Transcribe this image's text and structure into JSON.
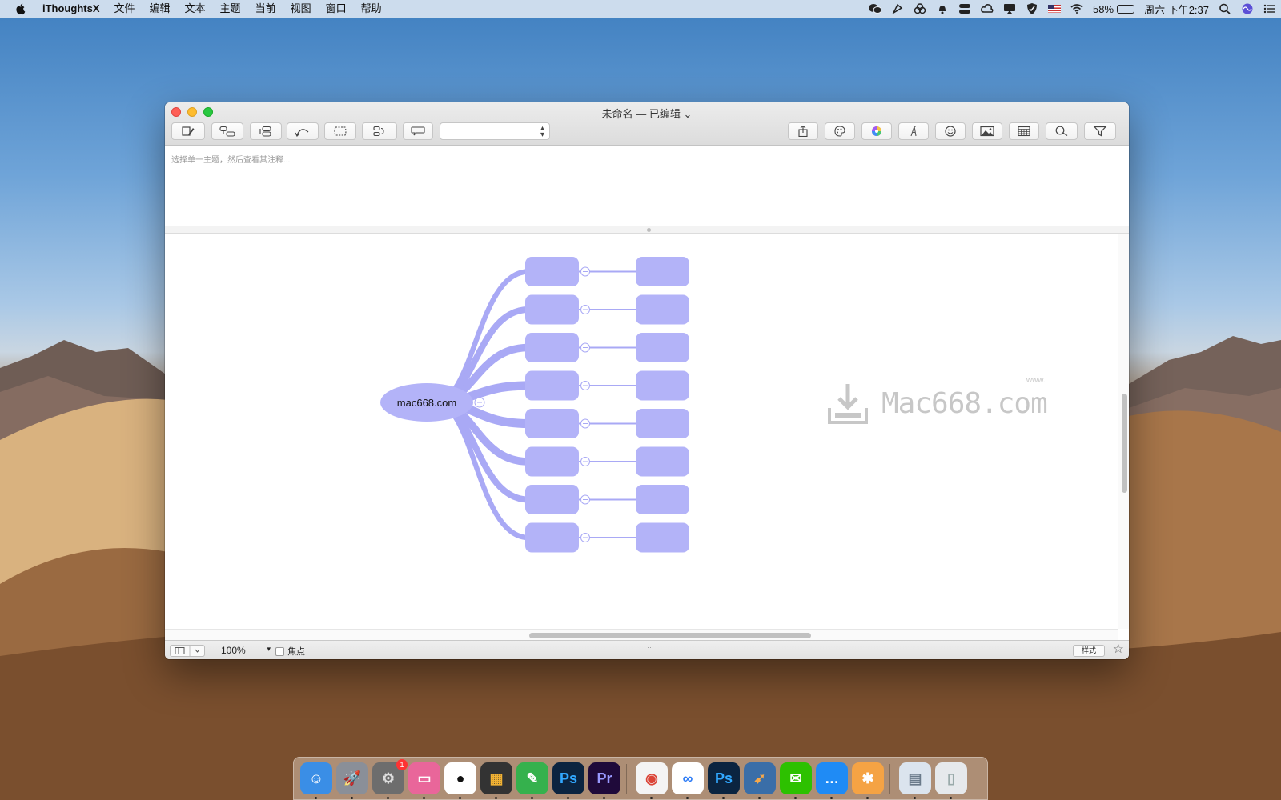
{
  "menubar": {
    "app_name": "iThoughtsX",
    "menus": [
      "文件",
      "编辑",
      "文本",
      "主题",
      "当前",
      "视图",
      "窗口",
      "帮助"
    ],
    "battery_percent": "58%",
    "battery_level": 0.58,
    "clock": "周六 下午2:37"
  },
  "window": {
    "title": "未命名 — 已编辑 ⌄",
    "notes_placeholder": "选择单一主题，然后查看其注释..."
  },
  "mindmap": {
    "root_label": "mac668.com",
    "node_color": "#b3b3f8",
    "branch_color": "#a9a9f5",
    "rows": 8
  },
  "watermark": {
    "text": "Mac668.com",
    "www": "www."
  },
  "statusbar": {
    "zoom": "100%",
    "focus_label": "焦点",
    "style_label": "样式"
  },
  "dock": {
    "apps": [
      {
        "name": "finder",
        "glyph": "☺",
        "bg": "#3a8ee6",
        "fg": "#fff"
      },
      {
        "name": "launchpad",
        "glyph": "🚀",
        "bg": "#8a8f98",
        "fg": "#fff"
      },
      {
        "name": "system-preferences",
        "glyph": "⚙",
        "bg": "#6d6d6d",
        "fg": "#ddd",
        "badge": "1"
      },
      {
        "name": "cleanmymac",
        "glyph": "▭",
        "bg": "#e9669a",
        "fg": "#fff"
      },
      {
        "name": "qq",
        "glyph": "●",
        "bg": "#ffffff",
        "fg": "#111"
      },
      {
        "name": "final-cut-pro",
        "glyph": "▦",
        "bg": "#333",
        "fg": "#f2b233"
      },
      {
        "name": "coda",
        "glyph": "✎",
        "bg": "#35b14d",
        "fg": "#fff"
      },
      {
        "name": "photoshop",
        "glyph": "Ps",
        "bg": "#0b2440",
        "fg": "#31a8ff"
      },
      {
        "name": "premiere",
        "glyph": "Pr",
        "bg": "#1f0a3a",
        "fg": "#9999ff"
      },
      {
        "name": "chrome",
        "glyph": "◉",
        "bg": "#f4f4f4",
        "fg": "#db4437"
      },
      {
        "name": "baidu-netdisk",
        "glyph": "∞",
        "bg": "#ffffff",
        "fg": "#2f7df6"
      },
      {
        "name": "photoshop-2",
        "glyph": "Ps",
        "bg": "#0b2440",
        "fg": "#31a8ff"
      },
      {
        "name": "rocket-typist",
        "glyph": "➹",
        "bg": "#3a6ea8",
        "fg": "#f7a84a"
      },
      {
        "name": "wechat",
        "glyph": "✉",
        "bg": "#2dc100",
        "fg": "#fff"
      },
      {
        "name": "messages",
        "glyph": "…",
        "bg": "#1f8bf5",
        "fg": "#fff"
      },
      {
        "name": "ithoughtsx",
        "glyph": "✱",
        "bg": "#f5a344",
        "fg": "#fff"
      },
      {
        "name": "preview",
        "glyph": "▤",
        "bg": "#dbe4ee",
        "fg": "#6a7a8a"
      },
      {
        "name": "trash",
        "glyph": "▯",
        "bg": "#e6e9ec",
        "fg": "#9aa"
      }
    ]
  }
}
